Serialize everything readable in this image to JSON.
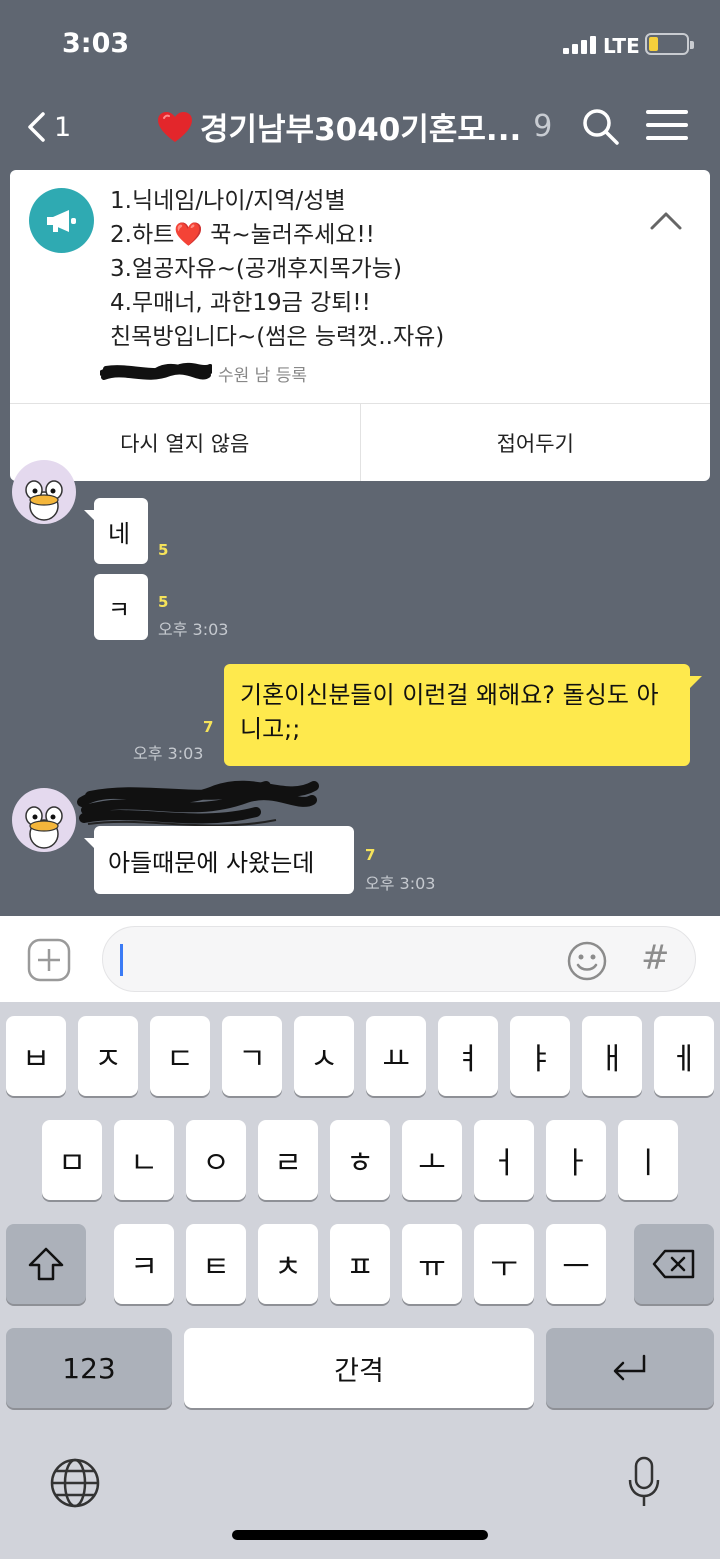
{
  "status_bar": {
    "time": "3:03",
    "network": "LTE",
    "battery_color": "#f5cf3b"
  },
  "header": {
    "back_count": "1",
    "title": "경기남부3040기혼모...",
    "member_count": "9"
  },
  "notice": {
    "lines": [
      "1.닉네임/나이/지역/성별",
      "2.하트❤️ 꾹~눌러주세요!!",
      "3.얼공자유~(공개후지목가능)",
      "4.무매너, 과한19금 강퇴!!",
      "친목방입니다~(썸은 능력껏..자유)"
    ],
    "author_suffix": "수원 남 등록",
    "dismiss_label": "다시 열지 않음",
    "collapse_label": "접어두기",
    "icon_color": "#2faab2"
  },
  "messages": [
    {
      "text": "네",
      "unread": "5"
    },
    {
      "text": "ㅋ",
      "unread": "5",
      "time": "오후 3:03"
    },
    {
      "text": "기혼이신분들이 이런걸 왜해요? 돌싱도 아니고;;",
      "unread": "7",
      "time": "오후 3:03",
      "mine": true
    },
    {
      "text": "아들때문에 사왔는데",
      "unread": "7",
      "time": "오후 3:03"
    }
  ],
  "input": {
    "placeholder": ""
  },
  "keyboard": {
    "row1": [
      "ㅂ",
      "ㅈ",
      "ㄷ",
      "ㄱ",
      "ㅅ",
      "ㅛ",
      "ㅕ",
      "ㅑ",
      "ㅐ",
      "ㅔ"
    ],
    "row2": [
      "ㅁ",
      "ㄴ",
      "ㅇ",
      "ㄹ",
      "ㅎ",
      "ㅗ",
      "ㅓ",
      "ㅏ",
      "ㅣ"
    ],
    "row3": [
      "ㅋ",
      "ㅌ",
      "ㅊ",
      "ㅍ",
      "ㅠ",
      "ㅜ",
      "ㅡ"
    ],
    "numbers_label": "123",
    "space_label": "간격"
  },
  "colors": {
    "chat_background": "#5f6671",
    "my_bubble": "#fee94d",
    "unread": "#f6e35a"
  }
}
